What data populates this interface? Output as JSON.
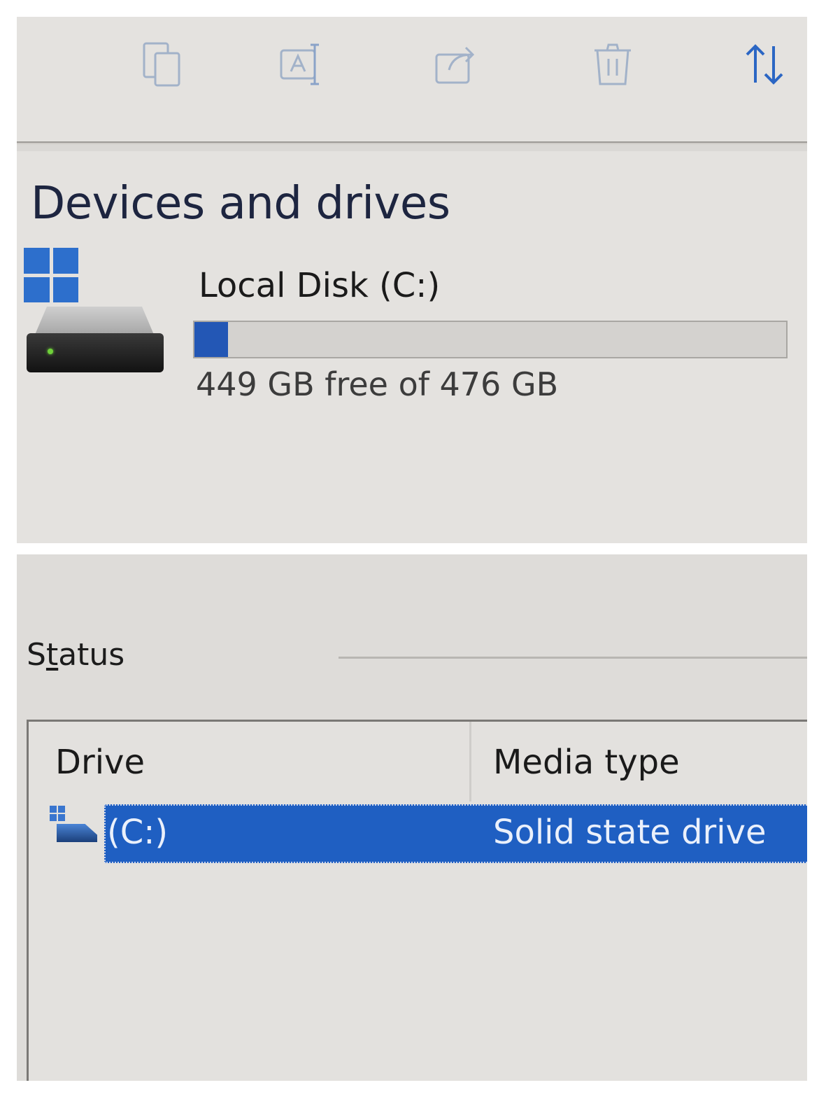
{
  "toolbar": {
    "icons": [
      {
        "name": "copy-icon"
      },
      {
        "name": "rename-icon"
      },
      {
        "name": "share-icon"
      },
      {
        "name": "delete-icon"
      },
      {
        "name": "sort-icon"
      }
    ]
  },
  "devices": {
    "section_title": "Devices and drives",
    "drive": {
      "name": "Local Disk (C:)",
      "free_text": "449 GB free of 476 GB",
      "used_fraction": 0.057,
      "icon": "hard-drive-icon"
    }
  },
  "status": {
    "label_before": "S",
    "label_access_key": "t",
    "label_after": "atus",
    "columns": {
      "drive": "Drive",
      "media_type": "Media type"
    },
    "rows": [
      {
        "drive": "(C:)",
        "media_type": "Solid state drive",
        "selected": true
      }
    ]
  },
  "colors": {
    "accent": "#2357b5",
    "selection": "#1f5fc2",
    "background": "#e4e2df"
  }
}
